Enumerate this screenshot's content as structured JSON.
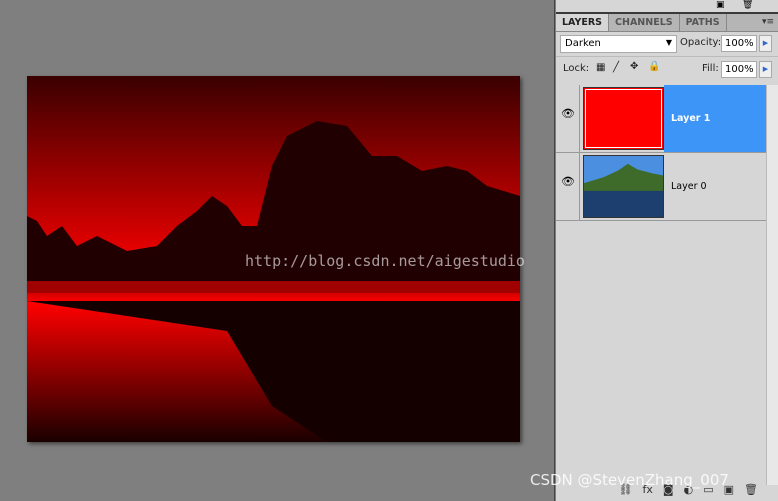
{
  "watermarks": {
    "center": "http://blog.csdn.net/aigestudio",
    "corner": "CSDN @StevenZhang_007"
  },
  "panel": {
    "tabs": [
      {
        "label": "LAYERS",
        "active": true
      },
      {
        "label": "CHANNELS"
      },
      {
        "label": "PATHS"
      }
    ],
    "blend_mode": "Darken",
    "opacity_label": "Opacity:",
    "opacity": "100%",
    "lock_label": "Lock:",
    "fill_label": "Fill:",
    "fill": "100%",
    "layers": [
      {
        "name": "Layer 1",
        "selected": true,
        "fill": "#ff0000"
      },
      {
        "name": "Layer 0",
        "selected": false
      }
    ],
    "selection_color": "#3d95f7"
  }
}
